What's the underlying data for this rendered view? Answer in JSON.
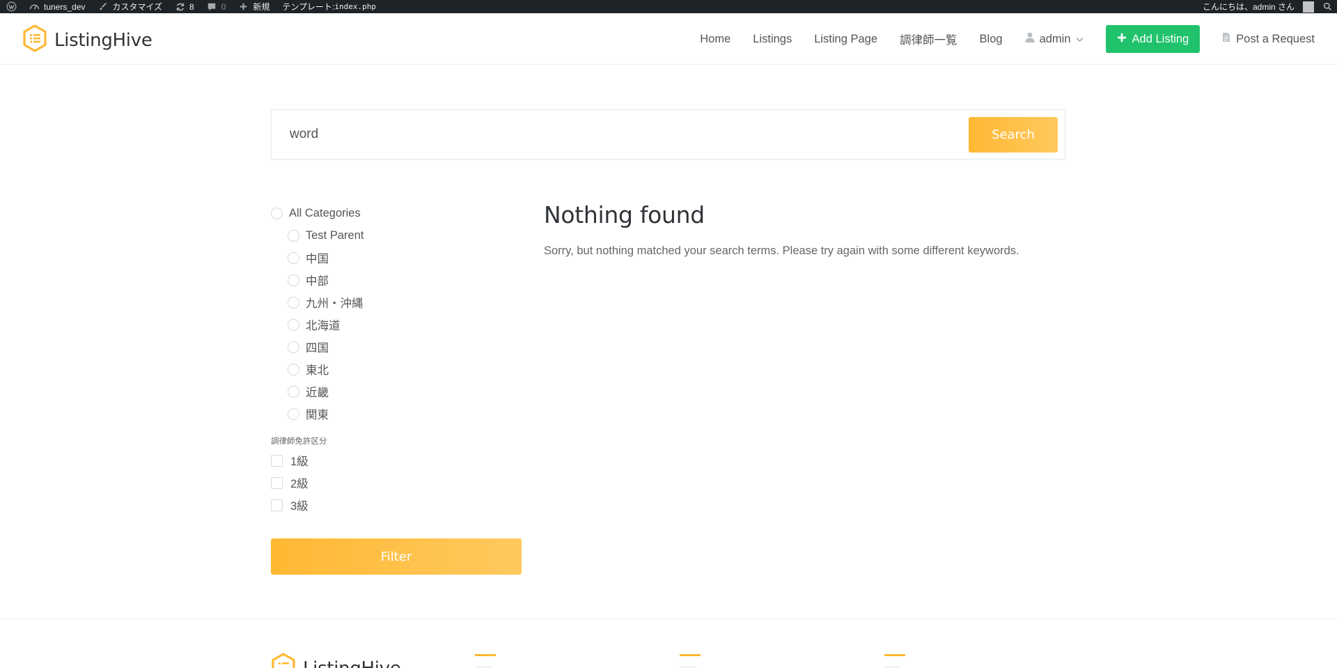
{
  "adminbar": {
    "site_name": "tuners_dev",
    "customize": "カスタマイズ",
    "updates_count": "8",
    "comments_count": "0",
    "new_label": "新規",
    "template_label": "テンプレート: ",
    "template_file": "index.php",
    "greeting": "こんにちは、admin さん"
  },
  "header": {
    "logo_text": "ListingHive",
    "nav": {
      "home": "Home",
      "listings": "Listings",
      "listing_page": "Listing Page",
      "tuners_list": "調律師一覧",
      "blog": "Blog",
      "user": "admin",
      "add_listing": "Add Listing",
      "post_request": "Post a Request"
    }
  },
  "search": {
    "value": "word",
    "button": "Search"
  },
  "filters": {
    "categories": [
      "All Categories",
      "Test Parent",
      "中国",
      "中部",
      "九州・沖縄",
      "北海道",
      "四国",
      "東北",
      "近畿",
      "関東"
    ],
    "license_label": "調律師免許区分",
    "license_options": [
      "1級",
      "2級",
      "3級"
    ],
    "filter_button": "Filter"
  },
  "main": {
    "title": "Nothing found",
    "message": "Sorry, but nothing matched your search terms. Please try again with some different keywords."
  },
  "footer": {
    "logo_text": "ListingHive"
  },
  "colors": {
    "accent": "#ffb833",
    "add_button": "#20c36c",
    "adminbar": "#1d2327"
  },
  "icons": [
    "wordpress-icon",
    "dashboard-icon",
    "brush-icon",
    "updates-icon",
    "comment-icon",
    "plus-icon",
    "user-icon",
    "chevron-down-icon",
    "document-icon",
    "search-icon",
    "logo-hexagon-icon"
  ]
}
